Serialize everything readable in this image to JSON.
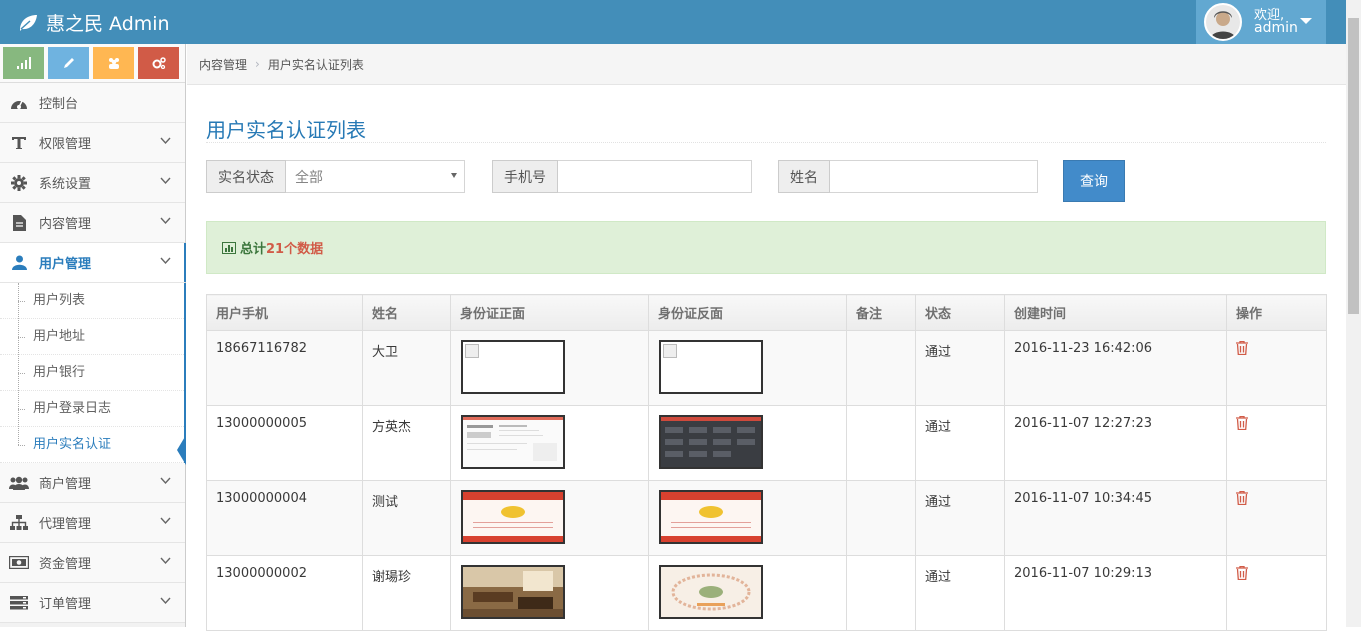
{
  "app": {
    "title": "惠之民 Admin"
  },
  "user": {
    "greeting": "欢迎,",
    "name": "admin"
  },
  "colors": {
    "navbar": "#438eb9",
    "accent": "#2b7dbc",
    "success_bg": "#dff0d8",
    "danger": "#d15b47"
  },
  "shortcuts": [
    {
      "icon": "signal-icon",
      "color": "#87b87f"
    },
    {
      "icon": "pencil-icon",
      "color": "#6fb3e0"
    },
    {
      "icon": "users-icon",
      "color": "#ffb752"
    },
    {
      "icon": "cogs-icon",
      "color": "#d15b47"
    }
  ],
  "sidebar": {
    "items": [
      {
        "label": "控制台",
        "icon": "dashboard-icon"
      },
      {
        "label": "权限管理",
        "icon": "text-icon"
      },
      {
        "label": "系统设置",
        "icon": "gear-icon"
      },
      {
        "label": "内容管理",
        "icon": "file-icon"
      },
      {
        "label": "用户管理",
        "icon": "user-icon"
      },
      {
        "label": "商户管理",
        "icon": "group-icon"
      },
      {
        "label": "代理管理",
        "icon": "sitemap-icon"
      },
      {
        "label": "资金管理",
        "icon": "money-icon"
      },
      {
        "label": "订单管理",
        "icon": "list-icon"
      }
    ],
    "sub_items": [
      {
        "label": "用户列表"
      },
      {
        "label": "用户地址"
      },
      {
        "label": "用户银行"
      },
      {
        "label": "用户登录日志"
      },
      {
        "label": "用户实名认证"
      }
    ]
  },
  "breadcrumb": {
    "parent": "内容管理",
    "current": "用户实名认证列表"
  },
  "page": {
    "title": "用户实名认证列表"
  },
  "filters": {
    "status_label": "实名状态",
    "status_value": "全部",
    "phone_label": "手机号",
    "phone_value": "",
    "name_label": "姓名",
    "name_value": "",
    "query_button": "查询"
  },
  "summary": {
    "prefix": "总计",
    "count": "21个数据"
  },
  "table": {
    "headers": [
      "用户手机",
      "姓名",
      "身份证正面",
      "身份证反面",
      "备注",
      "状态",
      "创建时间",
      "操作"
    ],
    "rows": [
      {
        "phone": "18667116782",
        "name": "大卫",
        "note": "",
        "status": "通过",
        "created": "2016-11-23 16:42:06"
      },
      {
        "phone": "13000000005",
        "name": "方英杰",
        "note": "",
        "status": "通过",
        "created": "2016-11-07 12:27:23"
      },
      {
        "phone": "13000000004",
        "name": "测试",
        "note": "",
        "status": "通过",
        "created": "2016-11-07 10:34:45"
      },
      {
        "phone": "13000000002",
        "name": "谢瑒珍",
        "note": "",
        "status": "通过",
        "created": "2016-11-07 10:29:13"
      }
    ]
  }
}
